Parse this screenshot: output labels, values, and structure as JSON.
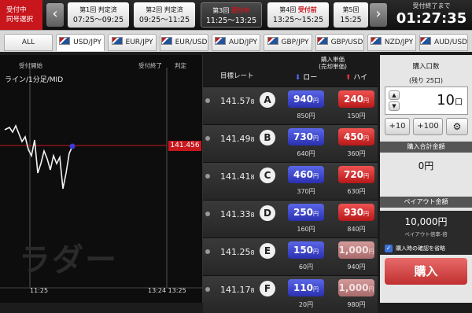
{
  "status": {
    "line1": "受付中",
    "line2": "同号選択"
  },
  "nav": {
    "prev": "‹",
    "next": "›"
  },
  "rounds": [
    {
      "label": "第1回 判定済",
      "time": "07:25～09:25"
    },
    {
      "label": "第2回 判定済",
      "time": "09:25～11:25"
    },
    {
      "label_a": "第3回 ",
      "label_b": "受付中",
      "time": "11:25～13:25"
    },
    {
      "label_a": "第4回 ",
      "label_b": "受付前",
      "time": "13:25～15:25"
    },
    {
      "label": "第5回",
      "time": "15:25"
    }
  ],
  "clock": {
    "label": "受付終了まで",
    "value": "01:27:35"
  },
  "tabs": [
    "ALL",
    "USD/JPY",
    "EUR/JPY",
    "EUR/USD",
    "AUD/JPY",
    "GBP/JPY",
    "GBP/USD",
    "NZD/JPY",
    "AUD/USD"
  ],
  "chart": {
    "start_label": "受付開始",
    "end_label": "受付終了",
    "judge_label": "判定",
    "title": "ライン/1分足/MID",
    "watermark": "ラダー",
    "current_rate": "141.456",
    "x_start": "11:25",
    "x_end_a": "13:24",
    "x_end_b": "13:25"
  },
  "ladder": {
    "target_label": "目標レート",
    "price_label": "購入単価",
    "price_sub": "(売却単価)",
    "low_label": "ロー",
    "high_label": "ハイ",
    "yen": "円",
    "rows": [
      {
        "int": "141.57",
        "dec": "8",
        "strike": "A",
        "low": "940",
        "high": "240",
        "low_sell": "850円",
        "high_sell": "150円",
        "high_dim": false
      },
      {
        "int": "141.49",
        "dec": "8",
        "strike": "B",
        "low": "730",
        "high": "450",
        "low_sell": "640円",
        "high_sell": "360円",
        "high_dim": false
      },
      {
        "int": "141.41",
        "dec": "8",
        "strike": "C",
        "low": "460",
        "high": "720",
        "low_sell": "370円",
        "high_sell": "630円",
        "high_dim": false
      },
      {
        "int": "141.33",
        "dec": "8",
        "strike": "D",
        "low": "250",
        "high": "930",
        "low_sell": "160円",
        "high_sell": "840円",
        "high_dim": false
      },
      {
        "int": "141.25",
        "dec": "8",
        "strike": "E",
        "low": "150",
        "high": "1,000",
        "low_sell": "60円",
        "high_sell": "940円",
        "high_dim": true
      },
      {
        "int": "141.17",
        "dec": "8",
        "strike": "F",
        "low": "110",
        "high": "1,000",
        "low_sell": "20円",
        "high_sell": "980円",
        "high_dim": true
      }
    ]
  },
  "panel": {
    "qty_title": "購入口数",
    "remaining": "(残り 25口)",
    "qty": "10",
    "unit": "口",
    "plus10": "+10",
    "plus100": "+100",
    "total_title": "購入合計金額",
    "total": "0円",
    "payout_title": "ペイアウト金額",
    "payout": "10,000円",
    "payout_sub": "ペイアウト倍率-倍",
    "confirm_label": "購入時の確認を省略",
    "buy_label": "購入"
  }
}
